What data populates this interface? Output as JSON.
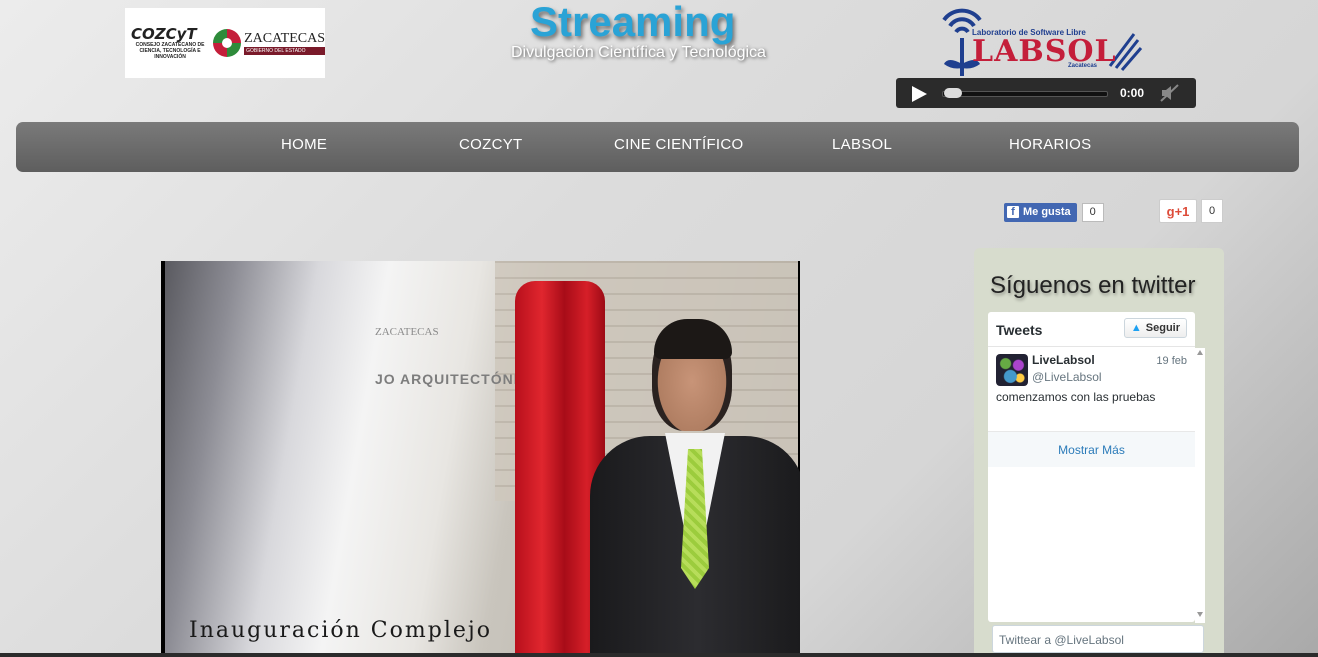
{
  "header": {
    "title": "Streaming",
    "subtitle": "Divulgación Científica y Tecnológica",
    "logo_left": {
      "cozcyt": "COZCyT",
      "cozcyt_sub": "CONSEJO ZACATECANO DE CIENCIA, TECNOLOGÍA E INNOVACIÓN",
      "zacatecas": "ZACATECAS",
      "zacatecas_sub": "GOBIERNO DEL ESTADO"
    },
    "logo_right": {
      "small": "Laboratorio de Software Libre",
      "big": "LABSOL",
      "city": "Zacatecas"
    }
  },
  "audio": {
    "time": "0:00",
    "progress": 0
  },
  "nav": {
    "items": [
      "HOME",
      "COZCYT",
      "CINE CIENTÍFICO",
      "LABSOL",
      "HORARIOS"
    ]
  },
  "social": {
    "fb_label": "Me gusta",
    "fb_count": "0",
    "gplus_label": "+1",
    "gplus_count": "0"
  },
  "video": {
    "caption": "Inauguración Complejo",
    "plaque": "JO ARQUITECTÓNICO",
    "plaque_logo": "ZACATECAS"
  },
  "twitter": {
    "heading": "Síguenos en twitter",
    "widget_title": "Tweets",
    "follow_label": "Seguir",
    "tweet": {
      "name": "LiveLabsol",
      "handle": "@LiveLabsol",
      "date": "19 feb",
      "text": "comenzamos con las pruebas"
    },
    "more_label": "Mostrar Más",
    "compose_placeholder": "Twittear a @LiveLabsol"
  },
  "colors": {
    "title": "#2aa3d6",
    "nav_bg": "#666666",
    "facebook": "#4267b2",
    "twitter_panel": "#d7dccd"
  }
}
